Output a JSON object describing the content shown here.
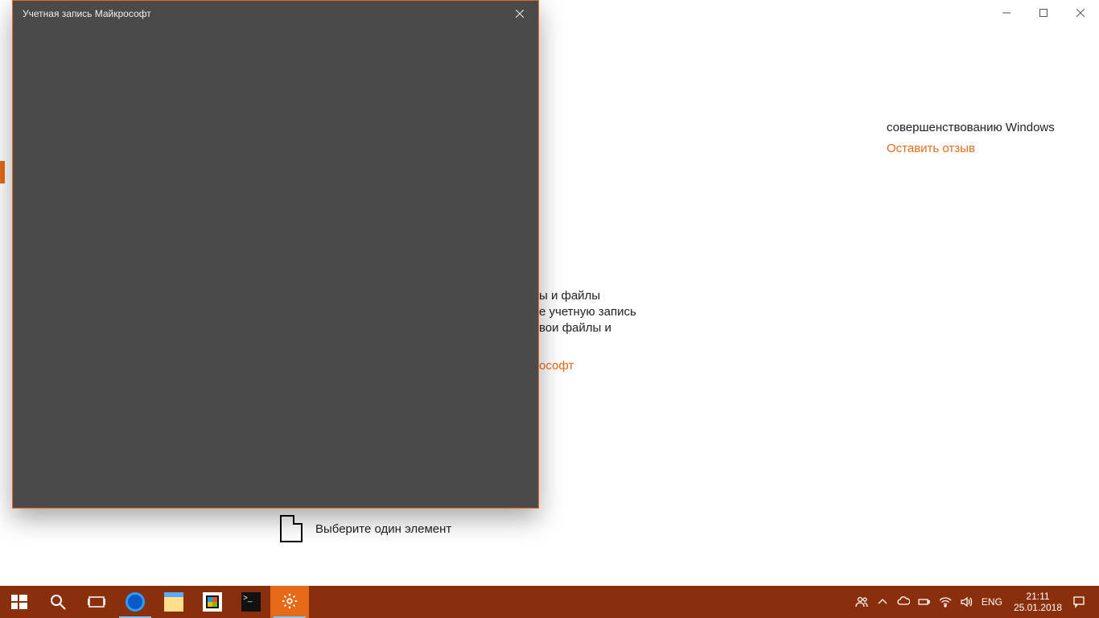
{
  "settings": {
    "feedback_text": "совершенствованию Windows",
    "feedback_link": "Оставить отзыв",
    "body_line1": "ы и файлы",
    "body_line2": "е учетную запись",
    "body_line3": "вои файлы и",
    "body_link": "ософт",
    "picker_label": "Выберите один элемент"
  },
  "popup": {
    "title": "Учетная запись Майкрософт"
  },
  "taskbar": {
    "lang": "ENG",
    "time": "21:11",
    "date": "25.01.2018"
  }
}
